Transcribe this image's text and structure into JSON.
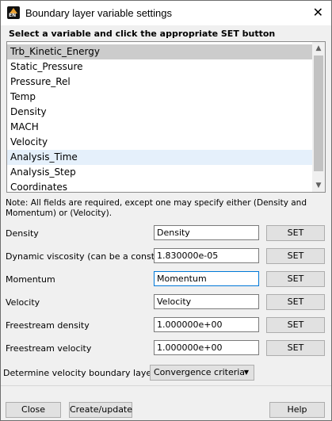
{
  "window": {
    "title": "Boundary layer variable settings",
    "close_glyph": "✕"
  },
  "heading": "Select a variable and click the appropriate SET button",
  "variables": [
    "Trb_Kinetic_Energy",
    "Static_Pressure",
    "Pressure_Rel",
    "Temp",
    "Density",
    "MACH",
    "Velocity",
    "Analysis_Time",
    "Analysis_Step",
    "Coordinates"
  ],
  "selected_variable": "Trb_Kinetic_Energy",
  "hovered_variable": "Analysis_Time",
  "note": "Note: All fields are required, except one may specify either (Density and Momentum)  or  (Velocity).",
  "rows": [
    {
      "label": "Density",
      "value": "Density",
      "set_label": "SET"
    },
    {
      "label": "Dynamic viscosity (can be a constant)",
      "value": "1.830000e-05",
      "set_label": "SET"
    },
    {
      "label": "Momentum",
      "value": "Momentum",
      "set_label": "SET"
    },
    {
      "label": "Velocity",
      "value": "Velocity",
      "set_label": "SET"
    },
    {
      "label": "Freestream density",
      "value": "1.000000e+00",
      "set_label": "SET"
    },
    {
      "label": "Freestream velocity",
      "value": "1.000000e+00",
      "set_label": "SET"
    }
  ],
  "determine": {
    "label": "Determine velocity boundary layer by",
    "selected": "Convergence criteria"
  },
  "buttons": {
    "close": "Close",
    "create_update": "Create/update",
    "help": "Help"
  },
  "scrollbar": {
    "up_glyph": "▲",
    "down_glyph": "▼"
  },
  "dropdown_glyph": "▼",
  "colors": {
    "selected_row": "#cccccc",
    "hover_row": "#e5f0fb",
    "focus_border": "#0078d7"
  }
}
